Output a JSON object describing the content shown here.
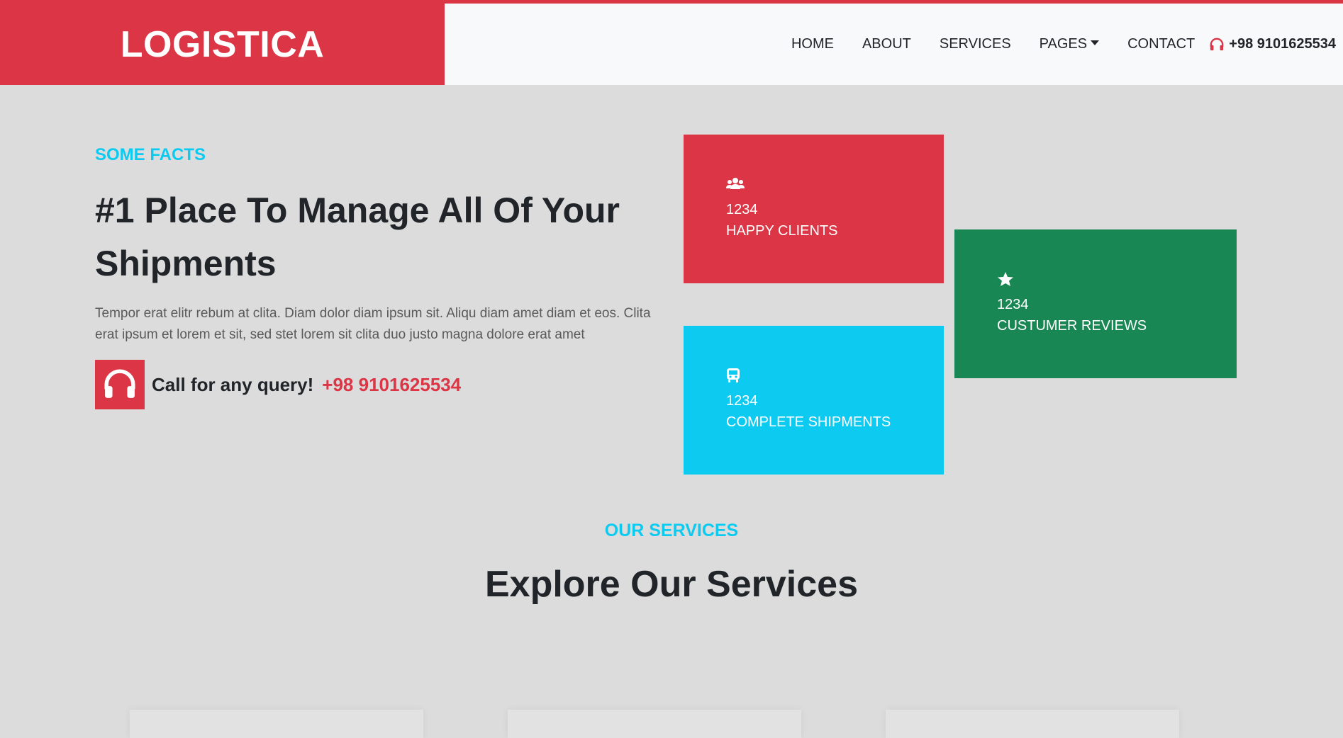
{
  "brand": {
    "name": "LOGISTICA",
    "color": "#dc3545"
  },
  "nav": {
    "items": [
      {
        "label": "HOME"
      },
      {
        "label": "ABOUT"
      },
      {
        "label": "SERVICES"
      },
      {
        "label": "PAGES"
      },
      {
        "label": "CONTACT"
      }
    ],
    "phone": "+98 9101625534",
    "phone_icon": "headphones-icon"
  },
  "facts": {
    "subtitle": "SOME FACTS",
    "headline": "#1 Place To Manage All Of Your Shipments",
    "paragraph": "Tempor erat elitr rebum at clita. Diam dolor diam ipsum sit. Aliqu diam amet diam et eos. Clita erat ipsum et lorem et sit, sed stet lorem sit clita duo justo magna dolore erat amet",
    "query_label": "Call for any query!",
    "query_phone": "+98 9101625534",
    "query_icon": "headphones-icon",
    "cards": [
      {
        "icon": "users-icon",
        "number": "1234",
        "label": "HAPPY CLIENTS",
        "color": "#dc3545"
      },
      {
        "icon": "star-icon",
        "number": "1234",
        "label": "CUSTUMER REVIEWS",
        "color": "#198754"
      },
      {
        "icon": "truck-icon",
        "number": "1234",
        "label": "COMPLETE SHIPMENTS",
        "color": "#0dcaf0"
      }
    ]
  },
  "services": {
    "subtitle": "OUR SERVICES",
    "title": "Explore Our Services"
  },
  "colors": {
    "accent_red": "#dc3545",
    "accent_cyan": "#0dcaf0",
    "accent_green": "#198754",
    "background": "#dcdcdc"
  }
}
